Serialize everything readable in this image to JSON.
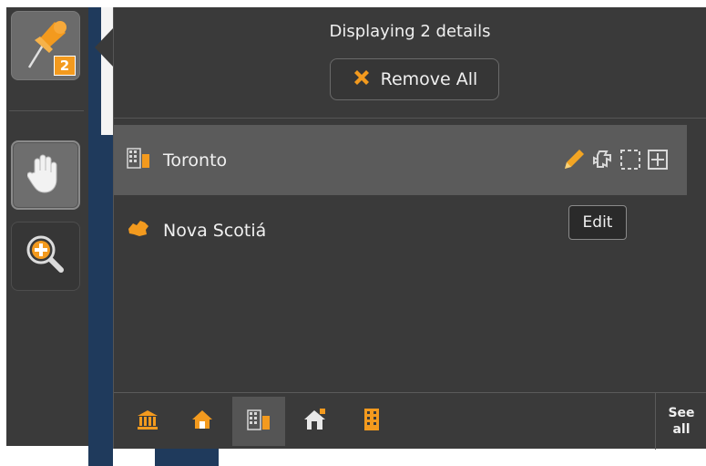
{
  "toolbar": {
    "pin_badge": "2",
    "tools": [
      "pushpin-icon",
      "hand-pan-icon",
      "zoom-in-icon"
    ]
  },
  "panel": {
    "title": "Displaying 2 details",
    "remove_all_label": "Remove All",
    "items": [
      {
        "label": "Toronto",
        "icon": "city-buildings-icon",
        "selected": true
      },
      {
        "label": "Nova Scotiá",
        "icon": "province-shape-icon",
        "selected": false
      }
    ],
    "row_tools": [
      "pencil-icon",
      "puzzle-icon",
      "dashed-select-icon",
      "plus-box-icon"
    ],
    "tooltip": "Edit",
    "categories": [
      "museum-icon",
      "house-icon",
      "city-buildings-icon",
      "house-alt-icon",
      "tall-building-icon"
    ],
    "active_category_index": 2,
    "see_all_line1": "See",
    "see_all_line2": "all"
  },
  "colors": {
    "accent": "#f39a1e",
    "panel_bg": "#3a3a3a",
    "selected_row": "#5b5b5b",
    "map_water": "#1f3a5c"
  }
}
